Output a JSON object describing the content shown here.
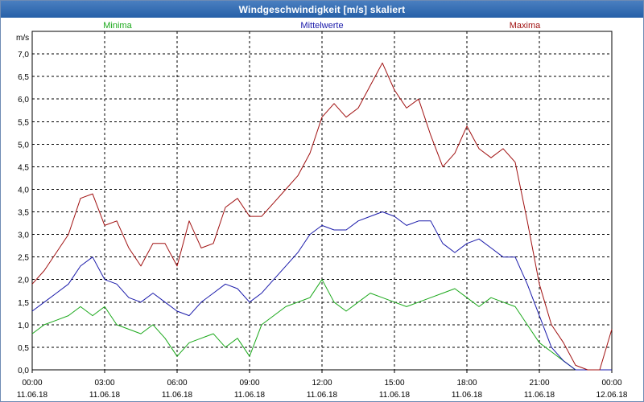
{
  "window": {
    "title": "Windgeschwindigkeit [m/s] skaliert"
  },
  "colors": {
    "min": "#1aa81a",
    "mean": "#1a1aaa",
    "max": "#a01010",
    "grid": "#000000"
  },
  "chart_data": {
    "type": "line",
    "title": "Windgeschwindigkeit [m/s] skaliert",
    "ylabel": "m/s",
    "ylim": [
      0,
      7.5
    ],
    "yticks": [
      "0,0",
      "0,5",
      "1,0",
      "1,5",
      "2,0",
      "2,5",
      "3,0",
      "3,5",
      "4,0",
      "4,5",
      "5,0",
      "5,5",
      "6,0",
      "6,5",
      "7,0"
    ],
    "xticks": [
      {
        "time": "00:00",
        "date": "11.06.18"
      },
      {
        "time": "03:00",
        "date": "11.06.18"
      },
      {
        "time": "06:00",
        "date": "11.06.18"
      },
      {
        "time": "09:00",
        "date": "11.06.18"
      },
      {
        "time": "12:00",
        "date": "11.06.18"
      },
      {
        "time": "15:00",
        "date": "11.06.18"
      },
      {
        "time": "18:00",
        "date": "11.06.18"
      },
      {
        "time": "21:00",
        "date": "11.06.18"
      },
      {
        "time": "00:00",
        "date": "12.06.18"
      }
    ],
    "x_hours": [
      0,
      0.5,
      1,
      1.5,
      2,
      2.5,
      3,
      3.5,
      4,
      4.5,
      5,
      5.5,
      6,
      6.5,
      7,
      7.5,
      8,
      8.5,
      9,
      9.5,
      10,
      10.5,
      11,
      11.5,
      12,
      12.5,
      13,
      13.5,
      14,
      14.5,
      15,
      15.5,
      16,
      16.5,
      17,
      17.5,
      18,
      18.5,
      19,
      19.5,
      20,
      20.5,
      21,
      21.5,
      22,
      22.5,
      23,
      23.5,
      24
    ],
    "legend": [
      "Minima",
      "Mittelwerte",
      "Maxima"
    ],
    "series": [
      {
        "name": "Minima",
        "color_key": "min",
        "values": [
          0.8,
          1.0,
          1.1,
          1.2,
          1.4,
          1.2,
          1.4,
          1.0,
          0.9,
          0.8,
          1.0,
          0.7,
          0.3,
          0.6,
          0.7,
          0.8,
          0.5,
          0.7,
          0.3,
          1.0,
          1.2,
          1.4,
          1.5,
          1.6,
          2.0,
          1.5,
          1.3,
          1.5,
          1.7,
          1.6,
          1.5,
          1.4,
          1.5,
          1.6,
          1.7,
          1.8,
          1.6,
          1.4,
          1.6,
          1.5,
          1.4,
          1.0,
          0.6,
          0.4,
          0.2,
          0.0,
          0.0,
          0.0,
          0.0
        ]
      },
      {
        "name": "Mittelwerte",
        "color_key": "mean",
        "values": [
          1.3,
          1.5,
          1.7,
          1.9,
          2.3,
          2.5,
          2.0,
          1.9,
          1.6,
          1.5,
          1.7,
          1.5,
          1.3,
          1.2,
          1.5,
          1.7,
          1.9,
          1.8,
          1.5,
          1.7,
          2.0,
          2.3,
          2.6,
          3.0,
          3.2,
          3.1,
          3.1,
          3.3,
          3.4,
          3.5,
          3.4,
          3.2,
          3.3,
          3.3,
          2.8,
          2.6,
          2.8,
          2.9,
          2.7,
          2.5,
          2.5,
          1.9,
          1.2,
          0.5,
          0.2,
          0.0,
          0.0,
          0.0,
          0.0
        ]
      },
      {
        "name": "Maxima",
        "color_key": "max",
        "values": [
          1.9,
          2.2,
          2.6,
          3.0,
          3.8,
          3.9,
          3.2,
          3.3,
          2.7,
          2.3,
          2.8,
          2.8,
          2.3,
          3.3,
          2.7,
          2.8,
          3.6,
          3.8,
          3.4,
          3.4,
          3.7,
          4.0,
          4.3,
          4.8,
          5.6,
          5.9,
          5.6,
          5.8,
          6.3,
          6.8,
          6.2,
          5.8,
          6.0,
          5.2,
          4.5,
          4.8,
          5.4,
          4.9,
          4.7,
          4.9,
          4.6,
          3.3,
          1.9,
          1.0,
          0.6,
          0.1,
          0.0,
          0.0,
          0.9
        ]
      }
    ]
  }
}
